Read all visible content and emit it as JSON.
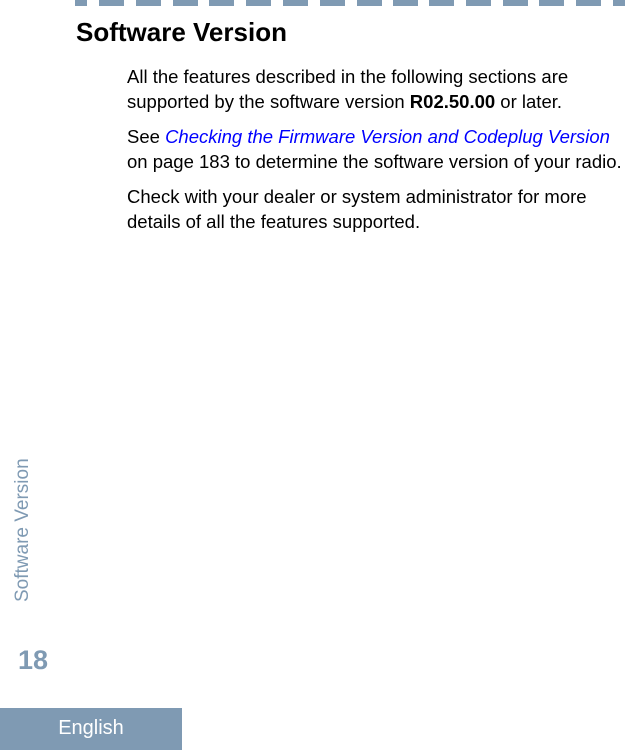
{
  "section": {
    "title": "Software Version"
  },
  "paragraphs": {
    "p1": {
      "before": "All the features described in the following sections are supported by the software version ",
      "version": "R02.50.00",
      "after": " or later."
    },
    "p2": {
      "before": "See ",
      "link": "Checking the Firmware Version and Codeplug Version",
      "after": " on page 183 to determine the software version of your radio."
    },
    "p3": {
      "text": "Check with your dealer or system administrator for more details of all the features supported."
    }
  },
  "margin": {
    "side_title": "Software Version",
    "page_number": "18",
    "language": "English"
  },
  "colors": {
    "accent": "#7f9ab3",
    "link": "#0000ff"
  }
}
